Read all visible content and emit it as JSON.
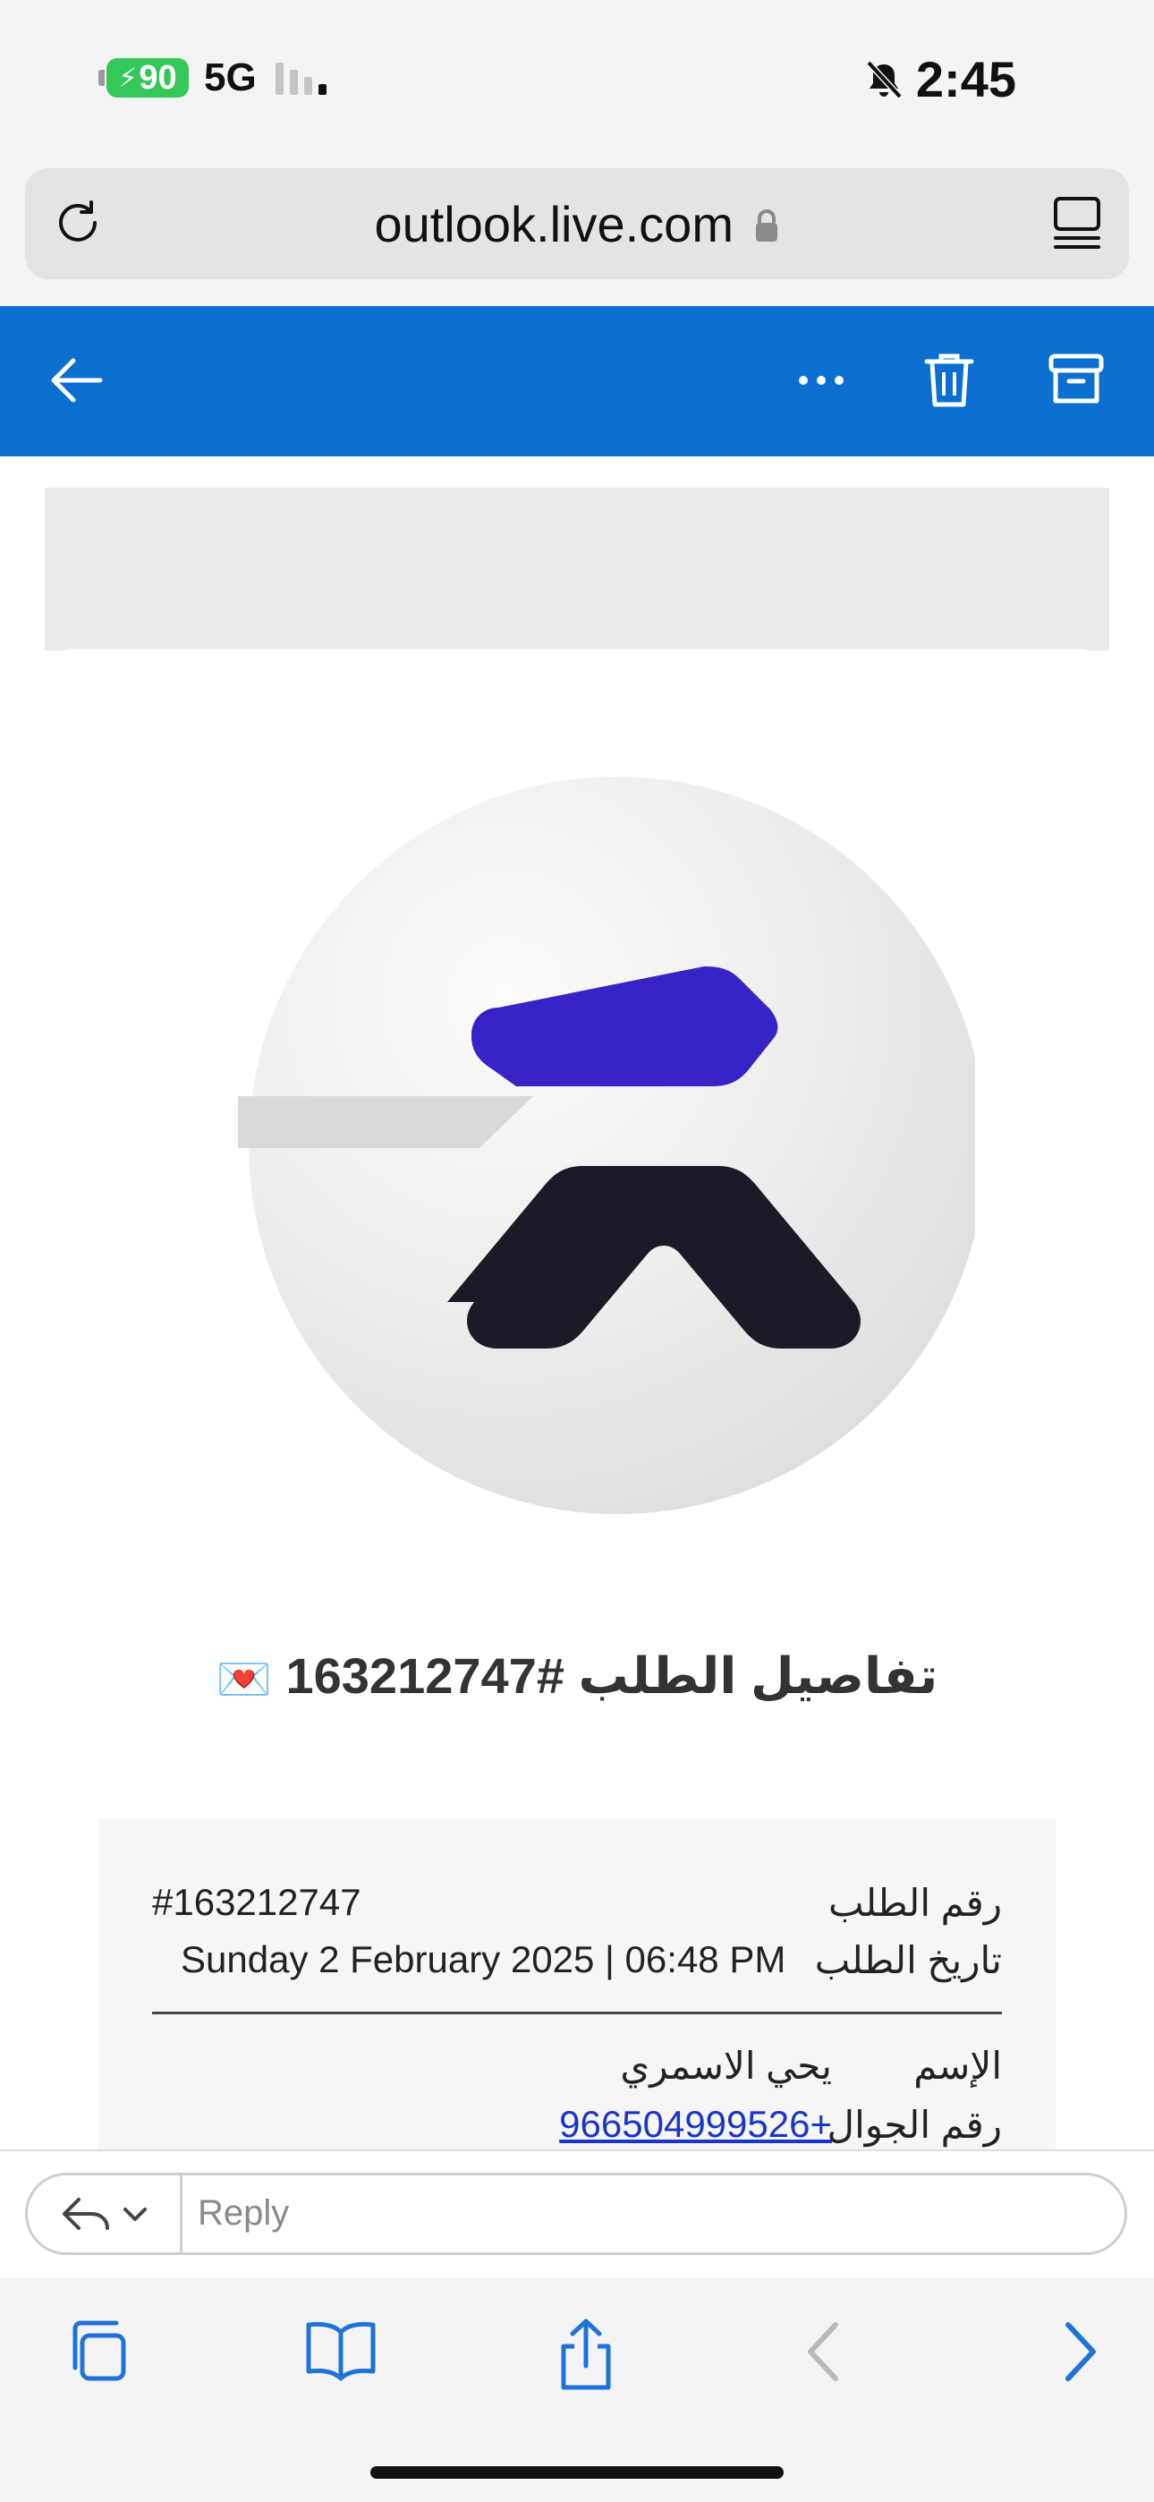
{
  "status_bar": {
    "battery": "90",
    "network": "5G",
    "time": "2:45",
    "icons": [
      "charging-bolt-icon",
      "signal-icon",
      "bell-slash-icon"
    ]
  },
  "browser": {
    "url": "outlook.live.com",
    "icons": [
      "reload-icon",
      "lock-icon",
      "tabs-icon"
    ]
  },
  "mail_header": {
    "icons": [
      "back-arrow-icon",
      "more-icon",
      "trash-icon",
      "archive-icon"
    ],
    "accent_color": "#0a6fd1"
  },
  "email": {
    "heading_text": "تفاصيل الطلب #163212747",
    "heading_emoji": "💌",
    "details": {
      "order_label": "رقم الطلب",
      "order_value": "#163212747",
      "date_label": "تاريخ الطلب",
      "date_value": "Sunday 2 February 2025 | 06:48 PM",
      "name_label": "الإسم",
      "name_value": "يحي الاسمري",
      "phone_label": "رقم الجوال",
      "phone_value": "966504999526+"
    },
    "logo_colors": {
      "top": "#3624c6",
      "bottom": "#1b1a26",
      "circle": "#e6e6e6"
    }
  },
  "reply": {
    "placeholder": "Reply"
  },
  "safari_toolbar": {
    "icons": [
      "tabs-overview-icon",
      "bookmarks-icon",
      "share-icon",
      "back-icon",
      "forward-icon"
    ]
  }
}
